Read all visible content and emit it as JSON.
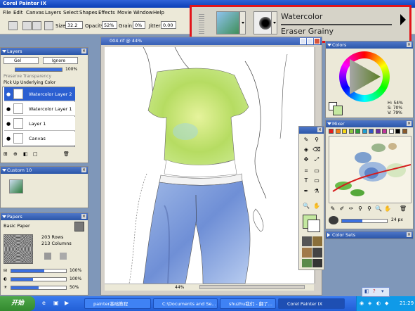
{
  "app": {
    "title": "Corel Painter IX"
  },
  "menu": [
    "File",
    "Edit",
    "Canvas",
    "Layers",
    "Select",
    "Shapes",
    "Effects",
    "Movie",
    "Window",
    "Help"
  ],
  "propbar": {
    "size_label": "Size:",
    "size_value": "32.2",
    "opacity_label": "Opacity:",
    "opacity_value": "52%",
    "grain_label": "Grain:",
    "grain_value": "0%",
    "jitter_label": "Jitter:",
    "jitter_value": "0.00"
  },
  "brush_selector": {
    "category": "Watercolor",
    "variant": "Eraser Grainy"
  },
  "layers": {
    "title": "Layers",
    "composite_method": "Gel",
    "depth_option": "Ignore",
    "opacity_value": "100%",
    "preserve_transparency": "Preserve Transparency",
    "pick_up_color": "Pick Up Underlying Color",
    "items": [
      {
        "name": "Watercolor Layer 2",
        "selected": true
      },
      {
        "name": "Watercolor Layer 1",
        "selected": false
      },
      {
        "name": "Layer 1",
        "selected": false
      },
      {
        "name": "Canvas",
        "selected": false
      }
    ]
  },
  "custom": {
    "title": "Custom 10"
  },
  "papers": {
    "title": "Papers",
    "name": "Basic Paper",
    "rows": "203 Rows",
    "columns": "213 Columns",
    "slider1_value": "100%",
    "slider2_value": "100%",
    "slider3_value": "50%"
  },
  "document": {
    "title": "004.rif @ 44%",
    "zoom": "44%"
  },
  "colors": {
    "title": "Colors",
    "h": "H: 54%",
    "s": "S: 70%",
    "v": "V: 79%",
    "main_color": "#c4e8a0",
    "secondary_color": "#ffffff"
  },
  "mixer": {
    "title": "Mixer",
    "brush_size": "24 px",
    "swatch_colors": [
      "#e31d1d",
      "#f07a14",
      "#f5d614",
      "#8cc63f",
      "#2d9b3a",
      "#21a0d2",
      "#2f56c4",
      "#6a2fa0",
      "#c2369a",
      "#ffffff",
      "#000000",
      "#8b5a2b"
    ]
  },
  "color_sets": {
    "title": "Color Sets"
  },
  "taskbar": {
    "start": "开始",
    "buttons": [
      {
        "label": "painter基础教程",
        "active": false
      },
      {
        "label": "C:\\Documents and Se...",
        "active": false
      },
      {
        "label": "shuzhu我们 - 翻了...",
        "active": false
      },
      {
        "label": "Corel Painter IX",
        "active": true
      }
    ],
    "clock": "21:29"
  }
}
